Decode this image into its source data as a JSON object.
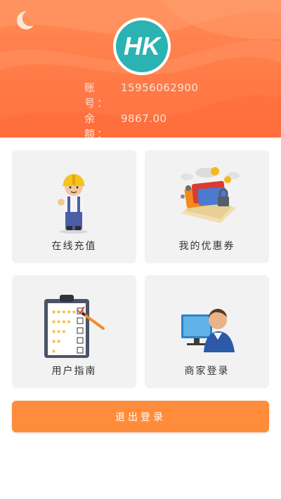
{
  "theme": {
    "accent": "#ff7b47",
    "card_bg": "#f2f2f2",
    "button_bg": "#ff8c3b",
    "logo_teal": "#2bb3b1"
  },
  "header": {
    "logo_text": "HK",
    "account_label": "账号：",
    "account_value": "15956062900",
    "balance_label": "余额：",
    "balance_value": "9867.00",
    "icon": "moon-icon"
  },
  "menu": [
    {
      "label": "在线充值",
      "icon": "worker-icon"
    },
    {
      "label": "我的优惠券",
      "icon": "coupon-cards-icon"
    },
    {
      "label": "用户指南",
      "icon": "clipboard-checklist-icon"
    },
    {
      "label": "商家登录",
      "icon": "merchant-computer-icon"
    }
  ],
  "logout_label": "退出登录"
}
